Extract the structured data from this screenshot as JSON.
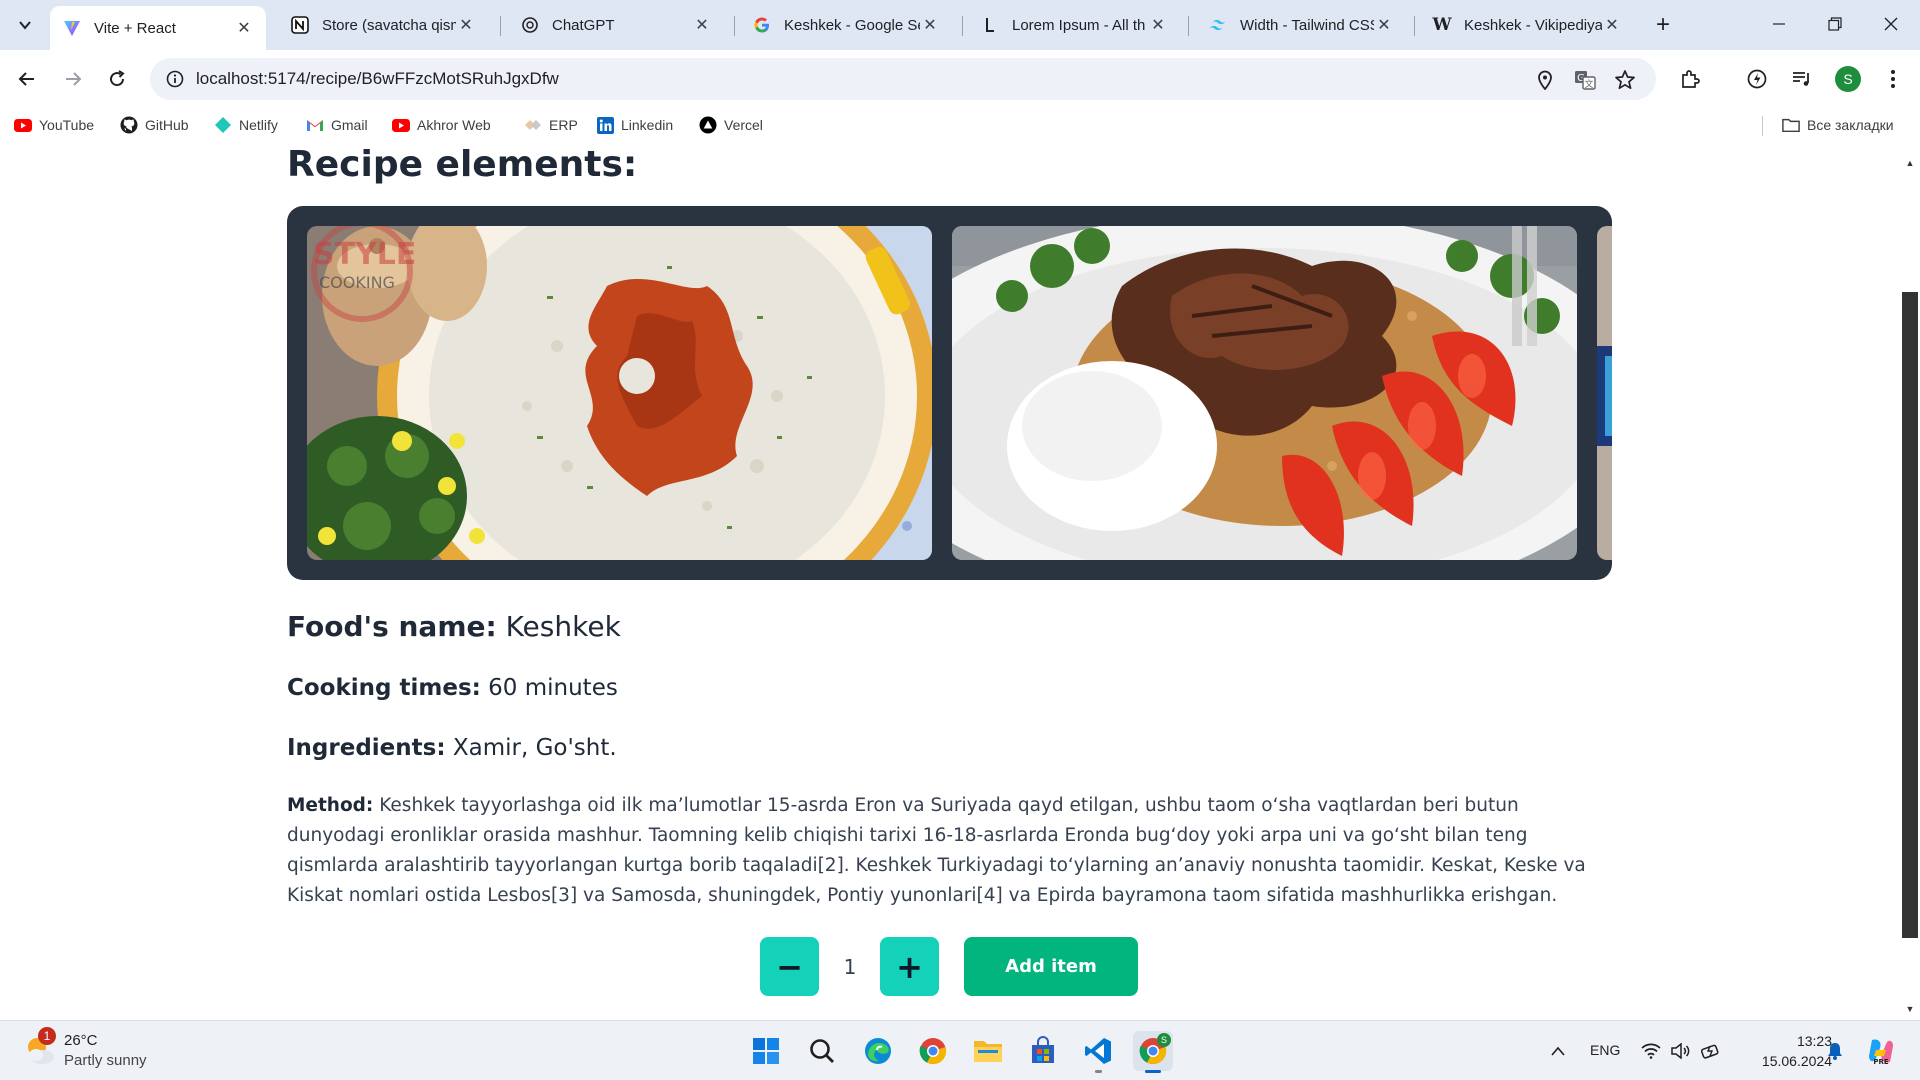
{
  "browser": {
    "tabs": [
      {
        "title": "Vite + React",
        "icon": "vite-icon",
        "active": true
      },
      {
        "title": "Store (savatcha qism",
        "icon": "notion-icon",
        "active": false
      },
      {
        "title": "ChatGPT",
        "icon": "chatgpt-icon",
        "active": false
      },
      {
        "title": "Keshkek - Google Se",
        "icon": "google-icon",
        "active": false
      },
      {
        "title": "Lorem Ipsum - All th",
        "icon": "lorem-ipsum-icon",
        "active": false
      },
      {
        "title": "Width - Tailwind CSS",
        "icon": "tailwind-icon",
        "active": false
      },
      {
        "title": "Keshkek - Vikipediya",
        "icon": "wikipedia-icon",
        "active": false
      }
    ],
    "url": "localhost:5174/recipe/B6wFFzcMotSRuhJgxDfw",
    "profile_initial": "S",
    "bookmarks": [
      {
        "label": "YouTube",
        "icon": "youtube-icon"
      },
      {
        "label": "GitHub",
        "icon": "github-icon"
      },
      {
        "label": "Netlify",
        "icon": "netlify-icon"
      },
      {
        "label": "Gmail",
        "icon": "gmail-icon"
      },
      {
        "label": "Akhror Web",
        "icon": "youtube-icon"
      },
      {
        "label": "ERP",
        "icon": "erp-icon"
      },
      {
        "label": "Linkedin",
        "icon": "linkedin-icon"
      },
      {
        "label": "Vercel",
        "icon": "vercel-icon"
      }
    ],
    "all_bookmarks_label": "Все закладки"
  },
  "page": {
    "heading": "Recipe elements:",
    "food_name_label": "Food's name:",
    "food_name": "Keshkek",
    "cooking_time_label": "Cooking times:",
    "cooking_time": "60 minutes",
    "ingredients_label": "Ingredients:",
    "ingredients": "Xamir, Go'sht.",
    "method_label": "Method:",
    "method": "Keshkek tayyorlashga oid ilk ma’lumotlar 15-asrda Eron va Suriyada qayd etilgan, ushbu taom oʻsha vaqtlardan beri butun dunyodagi eronliklar orasida mashhur. Taomning kelib chiqishi tarixi 16-18-asrlarda Eronda bugʻdoy yoki arpa uni va goʻsht bilan teng qismlarda aralashtirib tayyorlangan kurtga borib taqaladi[2]. Keshkek Turkiyadagi toʻylarning anʼanaviy nonushta taomidir. Keskat, Keske va Kiskat nomlari ostida Lesbos[3] va Samosda, shuningdek, Pontiy yunonlari[4] va Epirda bayramona taom sifatida mashhurlikka erishgan.",
    "quantity": "1",
    "minus_label": "−",
    "plus_label": "+",
    "add_button": "Add item",
    "slide_watermark_1": "STYLE",
    "slide_watermark_2": "COOKING"
  },
  "taskbar": {
    "weather_temp": "26°C",
    "weather_desc": "Partly sunny",
    "weather_badge": "1",
    "language": "ENG",
    "time": "13:23",
    "date": "15.06.2024"
  },
  "colors": {
    "accent_teal": "#14d1b9",
    "accent_green": "#02b47e",
    "carousel_bg": "#2a3441"
  }
}
